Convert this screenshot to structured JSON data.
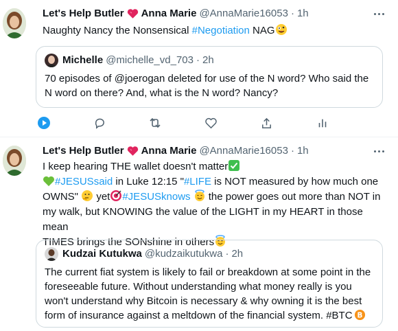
{
  "colors": {
    "link": "#1d9bf0",
    "muted": "#536471",
    "text": "#0f1419",
    "heart": "#e0245e",
    "border": "#cfd9de"
  },
  "tweets": [
    {
      "name": "Let's Help Butler",
      "name2": "Anna Marie",
      "handle": "@AnnaMarie16053",
      "time": "1h",
      "text_a": "Naughty Nancy the Nonsensical ",
      "hashtag": "#Negotiation",
      "text_b": " NAG",
      "quote": {
        "name": "Michelle",
        "handle": "@michelle_vd_703",
        "time": "2h",
        "text": "70 episodes of @joerogan deleted for use of the N word? Who said the N word on there? And, what is the N word? Nancy?"
      },
      "actions": [
        "play-icon",
        "reply-icon",
        "retweet-icon",
        "like-icon",
        "share-icon",
        "analytics-icon"
      ]
    },
    {
      "name": "Let's Help Butler",
      "name2": "Anna Marie",
      "handle": "@AnnaMarie16053",
      "time": "1h",
      "line1": "I keep hearing THE wallet doesn't matter",
      "tag1": "#JESUSsaid",
      "line2a": " in Luke 12:15 \"",
      "tag2": "#LIFE",
      "line2b": " is NOT measured by how much one",
      "line3a": "OWNS\" ",
      "line3b": " yet",
      "tag3": "#JESUSknows",
      "line3c": " the power goes out more than NOT in",
      "line4": "my walk, but KNOWING the value of the LIGHT in my HEART in those mean",
      "line5": "TIMES brings the SONshine in others",
      "quote": {
        "name": "Kudzai Kutukwa",
        "handle": "@kudzaikutukwa",
        "time": "2h",
        "text_a": "The current fiat system is likely to fail or breakdown at some point in the foreseeable future. Without understanding what money really is you won't understand why Bitcoin is necessary & why owning it is the best form of insurance against a meltdown of the financial system. ",
        "tag": "#BTC"
      }
    }
  ]
}
